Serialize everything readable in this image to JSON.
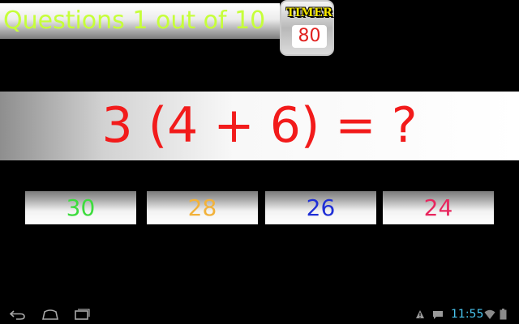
{
  "header": {
    "question_counter": "Questions 1 out of 10"
  },
  "timer": {
    "label": "TIMER",
    "value": "80"
  },
  "equation": {
    "text": "3 (4 + 6) = ?"
  },
  "answers": [
    {
      "label": "30",
      "color": "#3ddc3d"
    },
    {
      "label": "28",
      "color": "#f2b23a"
    },
    {
      "label": "26",
      "color": "#1f2fd6"
    },
    {
      "label": "24",
      "color": "#e8265e"
    }
  ],
  "system_bar": {
    "icons": [
      "back-icon",
      "home-icon",
      "recent-apps-icon",
      "warning-icon",
      "message-icon",
      "wifi-icon",
      "battery-icon"
    ],
    "time": "11:55",
    "clock_color": "#49c5ef"
  }
}
